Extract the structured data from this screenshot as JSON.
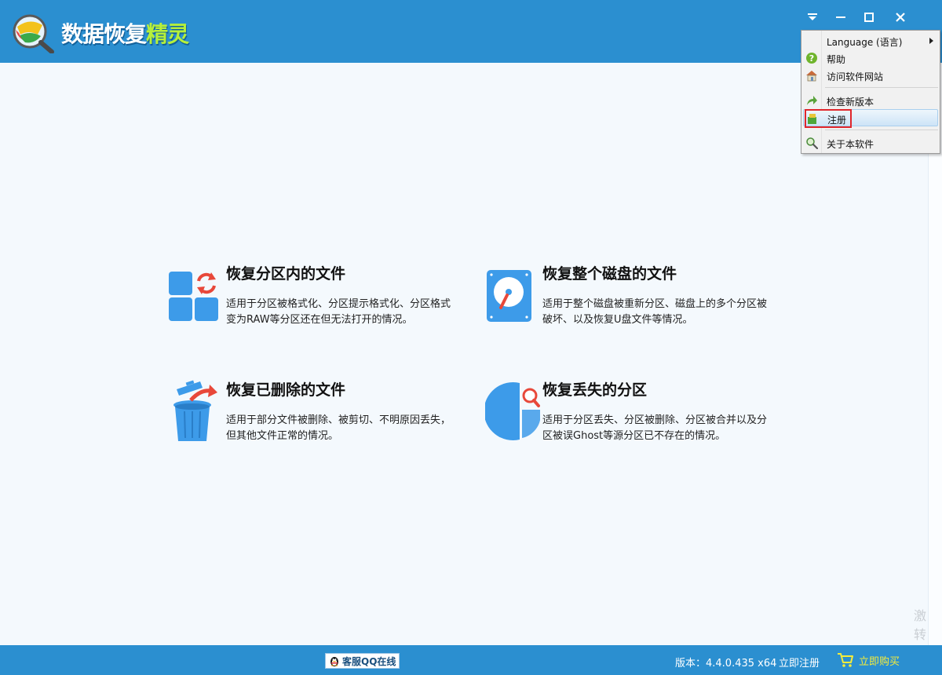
{
  "app": {
    "title_part1": "数据恢复",
    "title_part2": "精灵",
    "logo_icon": "magnifier-disk-logo",
    "brand_color": "#2b8fd0",
    "accent_color": "#b6f03a"
  },
  "window_controls": {
    "menu": "dropdown-triangle-icon",
    "minimize": "minimize-icon",
    "maximize": "maximize-icon",
    "close": "close-icon"
  },
  "cards": [
    {
      "title": "恢复分区内的文件",
      "desc": "适用于分区被格式化、分区提示格式化、分区格式变为RAW等分区还在但无法打开的情况。",
      "icon": "partition-recover-icon"
    },
    {
      "title": "恢复整个磁盘的文件",
      "desc": "适用于整个磁盘被重新分区、磁盘上的多个分区被破坏、以及恢复U盘文件等情况。",
      "icon": "hard-disk-icon"
    },
    {
      "title": "恢复已删除的文件",
      "desc": "适用于部分文件被删除、被剪切、不明原因丢失，但其他文件正常的情况。",
      "icon": "trash-bin-icon"
    },
    {
      "title": "恢复丢失的分区",
      "desc": "适用于分区丢失、分区被删除、分区被合并以及分区被误Ghost等源分区已不存在的情况。",
      "icon": "pie-search-icon"
    }
  ],
  "menu": {
    "items": [
      {
        "label": "Language (语言)",
        "icon": "",
        "submenu": true
      },
      {
        "label": "帮助",
        "icon": "help-icon"
      },
      {
        "label": "访问软件网站",
        "icon": "home-icon"
      },
      {
        "label": "检查新版本",
        "icon": "update-arrow-icon"
      },
      {
        "label": "注册",
        "icon": "register-key-icon",
        "highlighted": true
      },
      {
        "label": "关于本软件",
        "icon": "about-magnifier-icon"
      }
    ],
    "highlight_color": "#e0262c"
  },
  "status": {
    "qq_label": "客服QQ在线",
    "version": "版本：4.4.0.435 x64",
    "register_link": "立即注册",
    "buy_label": "立即购买",
    "buy_color": "#f6ec3a"
  },
  "watermark": {
    "line1": "激",
    "line2": "转"
  }
}
